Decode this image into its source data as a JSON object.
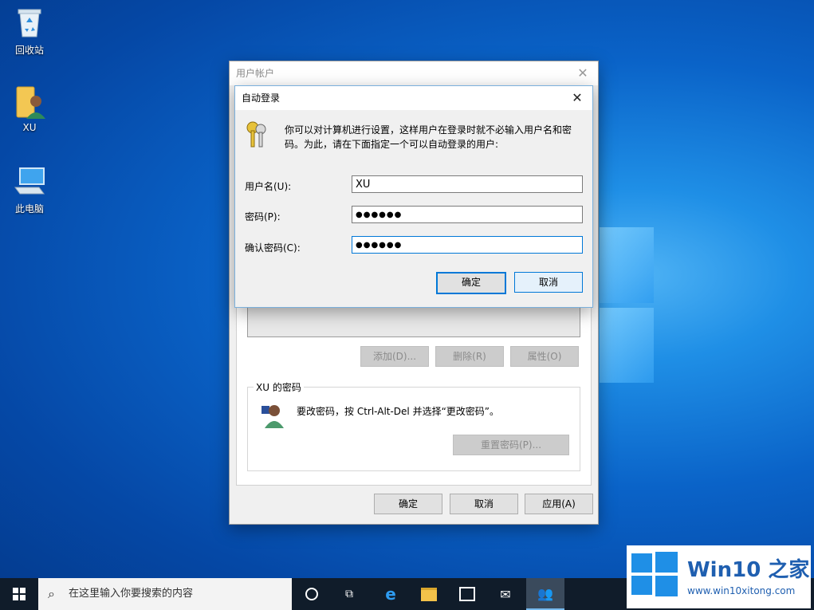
{
  "desktop": {
    "icons": [
      {
        "label": "回收站",
        "icon": "recycle-bin-icon"
      },
      {
        "label": "XU",
        "icon": "user-folder-icon"
      },
      {
        "label": "此电脑",
        "icon": "this-pc-icon"
      }
    ]
  },
  "user_accounts": {
    "title": "用户帐户",
    "add_label": "添加(D)...",
    "remove_label": "删除(R)",
    "properties_label": "属性(O)",
    "password_group_label": "XU 的密码",
    "password_hint": "要改密码，按 Ctrl-Alt-Del 并选择“更改密码”。",
    "reset_password_label": "重置密码(P)...",
    "ok_label": "确定",
    "cancel_label": "取消",
    "apply_label": "应用(A)"
  },
  "auto_login": {
    "title": "自动登录",
    "description": "你可以对计算机进行设置，这样用户在登录时就不必输入用户名和密码。为此，请在下面指定一个可以自动登录的用户:",
    "username_label": "用户名(U):",
    "username_value": "XU",
    "password_label": "密码(P):",
    "password_value": "●●●●●●",
    "confirm_label": "确认密码(C):",
    "confirm_value": "●●●●●●",
    "ok_label": "确定",
    "cancel_label": "取消"
  },
  "taskbar": {
    "search_placeholder": "在这里输入你要搜索的内容"
  },
  "watermark": {
    "brand": "Win10 之家",
    "url": "www.win10xitong.com"
  },
  "colors": {
    "accent": "#0078d7",
    "taskbar": "#101c2a"
  }
}
